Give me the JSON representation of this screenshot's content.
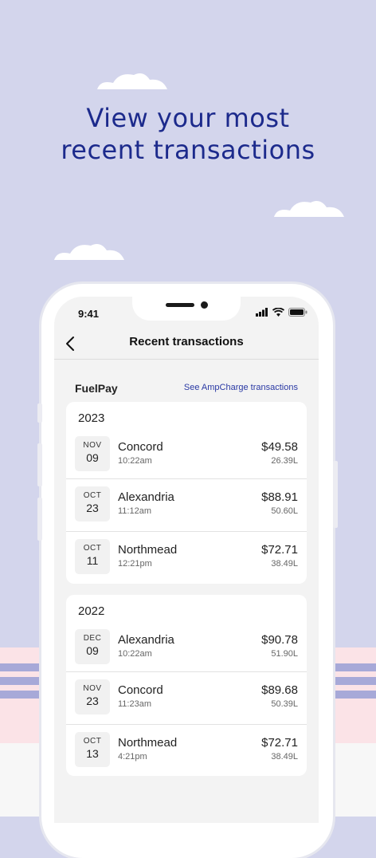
{
  "hero": {
    "line1": "View your most",
    "line2": "recent transactions"
  },
  "status": {
    "time": "9:41"
  },
  "nav": {
    "title": "Recent transactions"
  },
  "section": {
    "title": "FuelPay",
    "link": "See AmpCharge transactions"
  },
  "groups": [
    {
      "year": "2023",
      "rows": [
        {
          "month": "NOV",
          "day": "09",
          "place": "Concord",
          "time": "10:22am",
          "amount": "$49.58",
          "litres": "26.39L"
        },
        {
          "month": "OCT",
          "day": "23",
          "place": "Alexandria",
          "time": "11:12am",
          "amount": "$88.91",
          "litres": "50.60L"
        },
        {
          "month": "OCT",
          "day": "11",
          "place": "Northmead",
          "time": "12:21pm",
          "amount": "$72.71",
          "litres": "38.49L"
        }
      ]
    },
    {
      "year": "2022",
      "rows": [
        {
          "month": "DEC",
          "day": "09",
          "place": "Alexandria",
          "time": "10:22am",
          "amount": "$90.78",
          "litres": "51.90L"
        },
        {
          "month": "NOV",
          "day": "23",
          "place": "Concord",
          "time": "11:23am",
          "amount": "$89.68",
          "litres": "50.39L"
        },
        {
          "month": "OCT",
          "day": "13",
          "place": "Northmead",
          "time": "4:21pm",
          "amount": "$72.71",
          "litres": "38.49L"
        }
      ]
    }
  ],
  "colors": {
    "background": "#d3d5ec",
    "heading": "#1c2a8c",
    "link": "#2a39a4",
    "stripe": "#a7a9d8",
    "pink": "#fbe3e7"
  },
  "icons": [
    "cloud-icon",
    "back-arrow-icon",
    "signal-icon",
    "wifi-icon",
    "battery-icon"
  ]
}
